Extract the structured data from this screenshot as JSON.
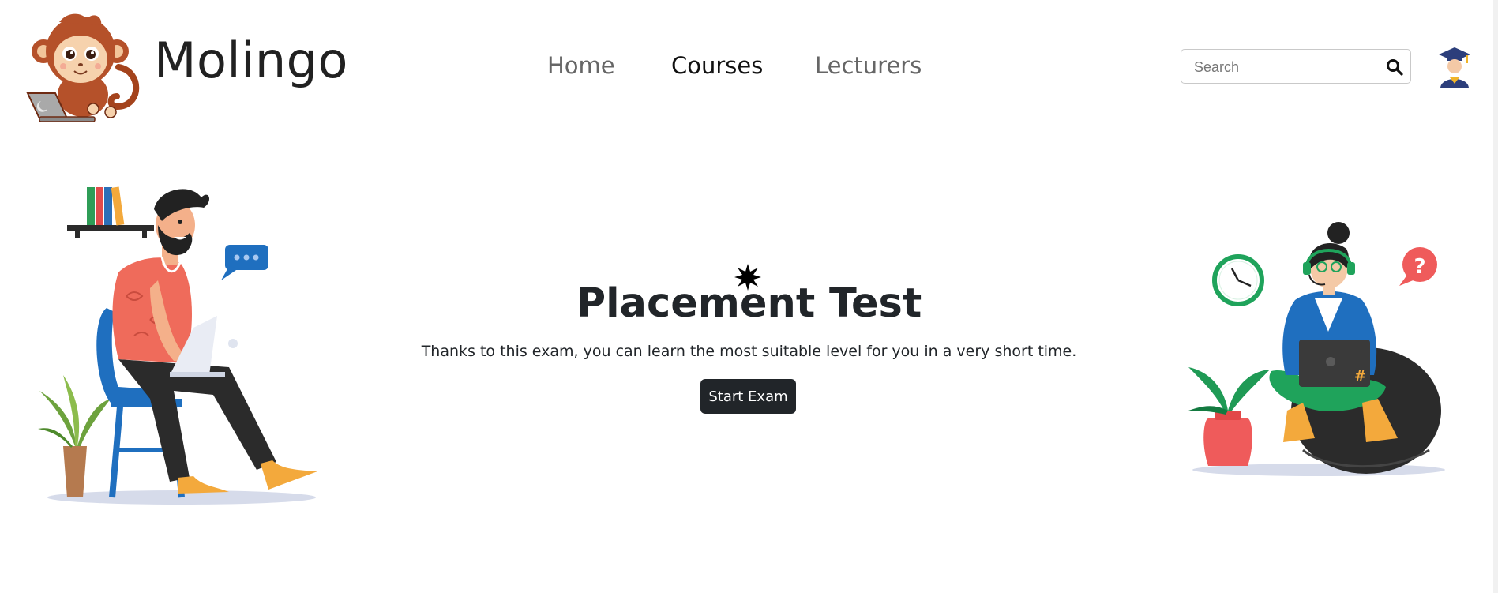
{
  "brand": {
    "name": "Molingo",
    "logo_icon": "monkey-laptop-logo"
  },
  "nav": {
    "items": [
      {
        "label": "Home",
        "active": false
      },
      {
        "label": "Courses",
        "active": true
      },
      {
        "label": "Lecturers",
        "active": false
      }
    ]
  },
  "search": {
    "placeholder": "Search",
    "value": "",
    "icon": "search-icon"
  },
  "profile": {
    "icon": "graduate-avatar-icon"
  },
  "hero": {
    "title": "Placement Test",
    "subtitle": "Thanks to this exam, you can learn the most suitable level for you in a very short time.",
    "button_label": "Start Exam"
  },
  "colors": {
    "dark": "#212529",
    "nav_inactive": "#666666",
    "accent_blue": "#1f6fbf",
    "accent_red": "#ef5b5b",
    "accent_green": "#1fa35b",
    "accent_orange": "#f3a93c"
  }
}
